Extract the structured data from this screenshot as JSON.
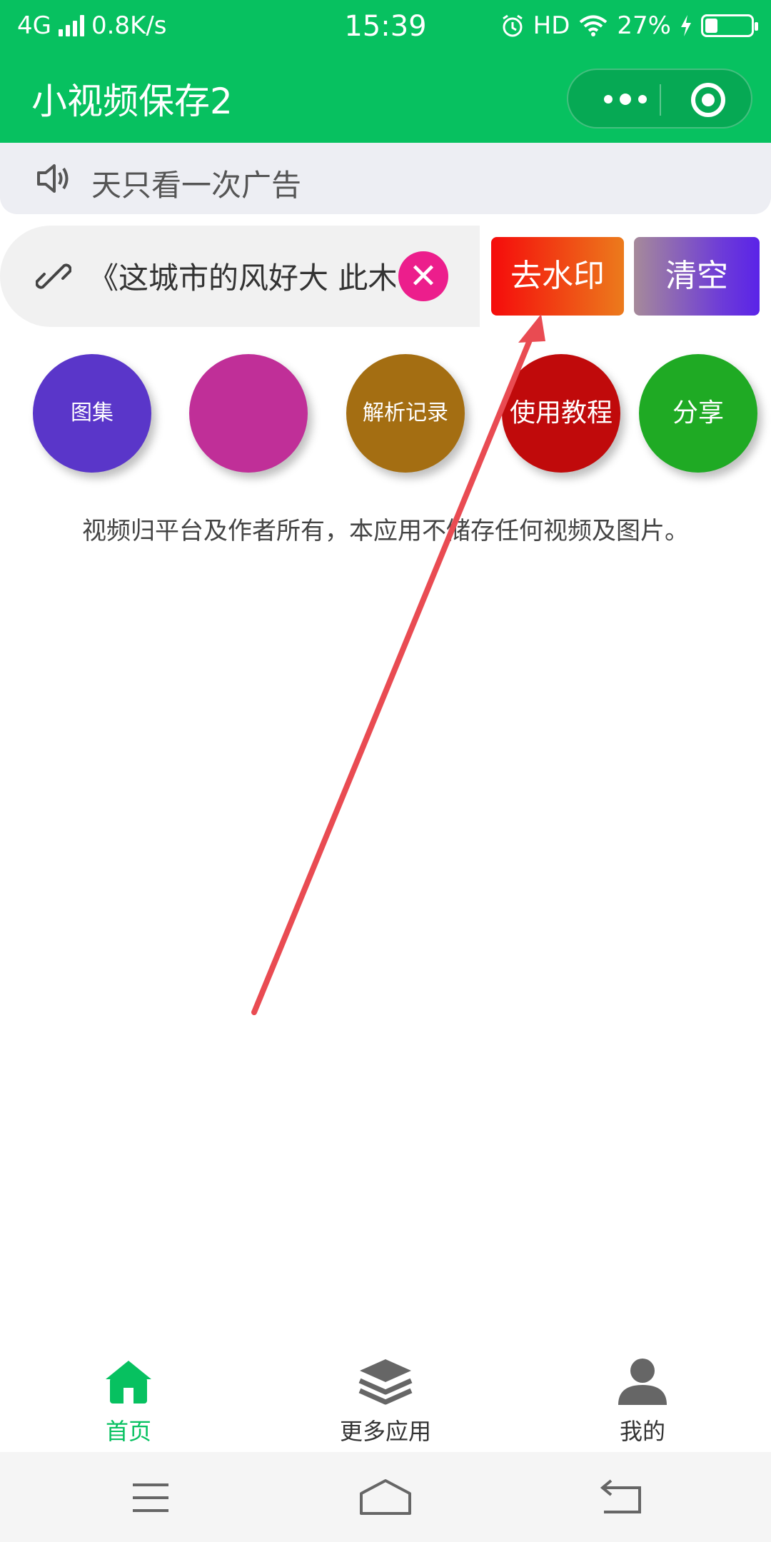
{
  "status_bar": {
    "network": "4G",
    "speed": "0.8K/s",
    "time": "15:39",
    "hd": "HD",
    "battery": "27%",
    "battery_level": 0.27
  },
  "nav": {
    "title": "小视频保存2"
  },
  "notice": {
    "text": "天只看一次广告"
  },
  "input": {
    "value": "《这城市的风好大 此木"
  },
  "buttons": {
    "remove_watermark": "去水印",
    "clear": "清空"
  },
  "circles": {
    "gallery": "图集",
    "blank": "",
    "history": "解析记录",
    "tutorial": "使用教程",
    "share": "分享"
  },
  "disclaimer": "视频归平台及作者所有，本应用不储存任何视频及图片。",
  "tabbar": {
    "items": [
      {
        "label": "首页",
        "icon": "home-icon",
        "active": true
      },
      {
        "label": "更多应用",
        "icon": "layers-icon",
        "active": false
      },
      {
        "label": "我的",
        "icon": "user-icon",
        "active": false
      }
    ]
  },
  "colors": {
    "brand_green": "#07c160",
    "clear_x": "#ec1e8c",
    "annotation_arrow": "#e94b52"
  }
}
